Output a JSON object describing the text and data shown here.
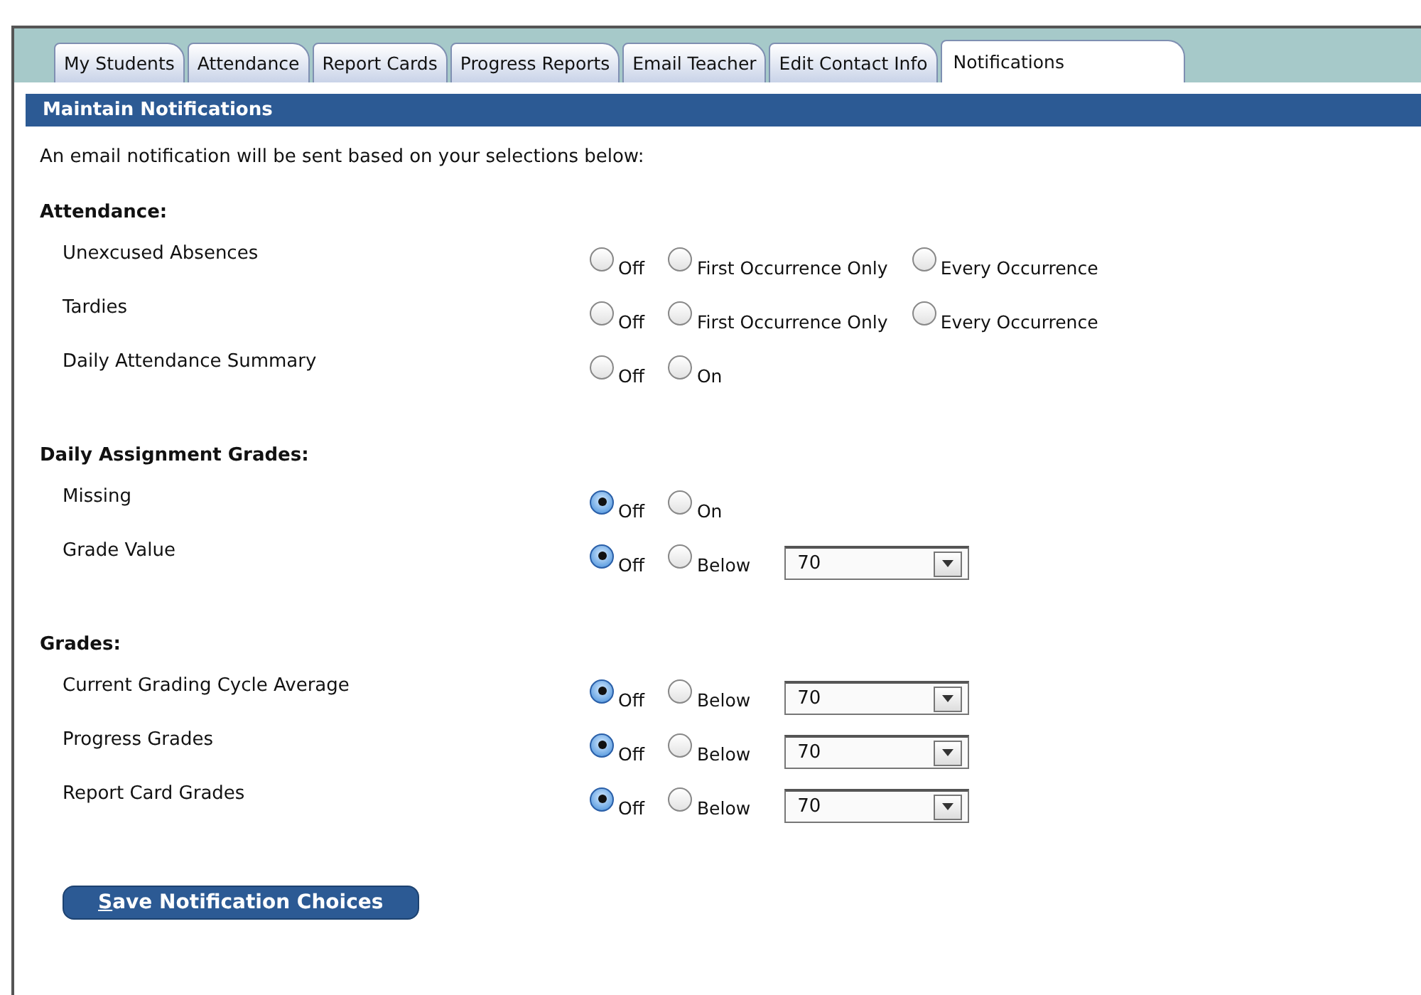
{
  "tabs": [
    {
      "label": "My Students",
      "selected": false
    },
    {
      "label": "Attendance",
      "selected": false
    },
    {
      "label": "Report Cards",
      "selected": false
    },
    {
      "label": "Progress Reports",
      "selected": false
    },
    {
      "label": "Email Teacher",
      "selected": false
    },
    {
      "label": "Edit Contact Info",
      "selected": false
    },
    {
      "label": "Notifications",
      "selected": true
    }
  ],
  "panel_title": "Maintain Notifications",
  "intro": "An email notification will be sent based on your selections below:",
  "sections": [
    {
      "title": "Attendance:",
      "rows": [
        {
          "label": "Unexcused Absences",
          "options": [
            {
              "label": "Off",
              "selected": false
            },
            {
              "label": "First Occurrence Only",
              "selected": false
            },
            {
              "label": "Every Occurrence",
              "selected": false
            }
          ]
        },
        {
          "label": "Tardies",
          "options": [
            {
              "label": "Off",
              "selected": false
            },
            {
              "label": "First Occurrence Only",
              "selected": false
            },
            {
              "label": "Every Occurrence",
              "selected": false
            }
          ]
        },
        {
          "label": "Daily Attendance Summary",
          "options": [
            {
              "label": "Off",
              "selected": false
            },
            {
              "label": "On",
              "selected": false
            }
          ]
        }
      ]
    },
    {
      "title": "Daily Assignment Grades:",
      "rows": [
        {
          "label": "Missing",
          "options": [
            {
              "label": "Off",
              "selected": true
            },
            {
              "label": "On",
              "selected": false
            }
          ]
        },
        {
          "label": "Grade Value",
          "options": [
            {
              "label": "Off",
              "selected": true
            },
            {
              "label": "Below",
              "selected": false
            }
          ],
          "dropdown": "70"
        }
      ]
    },
    {
      "title": "Grades:",
      "rows": [
        {
          "label": "Current Grading Cycle Average",
          "options": [
            {
              "label": "Off",
              "selected": true
            },
            {
              "label": "Below",
              "selected": false
            }
          ],
          "dropdown": "70"
        },
        {
          "label": "Progress Grades",
          "options": [
            {
              "label": "Off",
              "selected": true
            },
            {
              "label": "Below",
              "selected": false
            }
          ],
          "dropdown": "70"
        },
        {
          "label": "Report Card Grades",
          "options": [
            {
              "label": "Off",
              "selected": true
            },
            {
              "label": "Below",
              "selected": false
            }
          ],
          "dropdown": "70"
        }
      ]
    }
  ],
  "save_button": "Save Notification Choices"
}
